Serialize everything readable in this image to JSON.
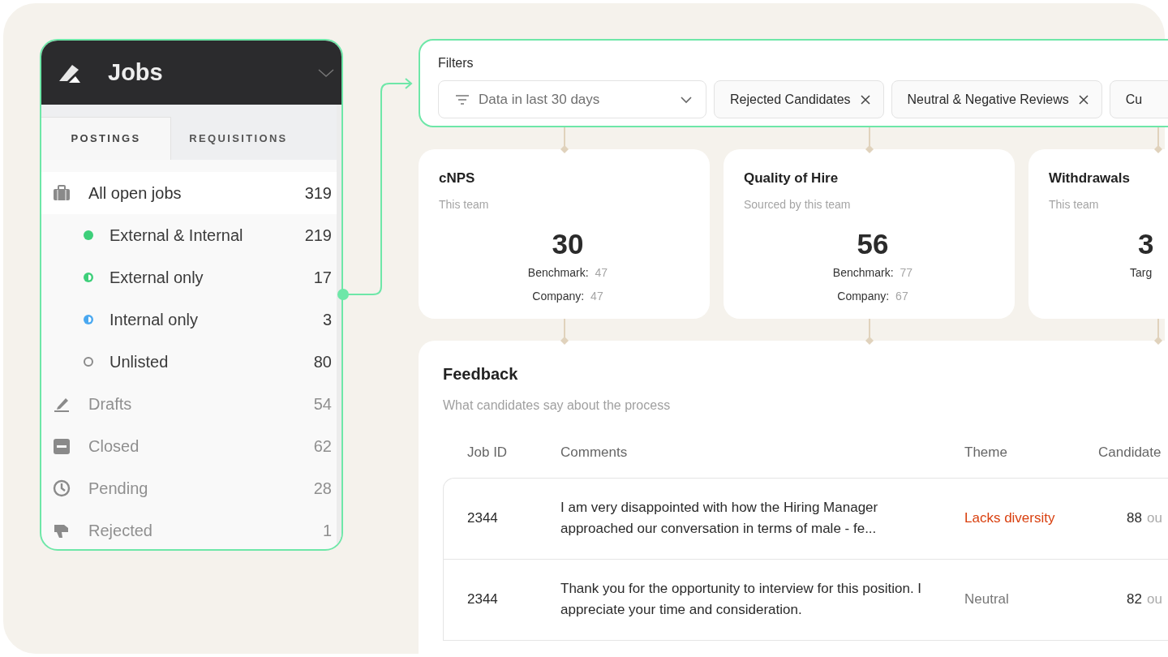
{
  "sidebar": {
    "title": "Jobs",
    "tabs": [
      {
        "label": "POSTINGS",
        "selected": true
      },
      {
        "label": "REQUISITIONS",
        "selected": false
      }
    ],
    "items": [
      {
        "label": "All open jobs",
        "count": "319",
        "kind": "briefcase",
        "selected": true,
        "children": [
          {
            "label": "External & Internal",
            "count": "219",
            "kind": "full",
            "color": "#3ecf7a"
          },
          {
            "label": "External only",
            "count": "17",
            "kind": "half",
            "color": "#3ecf7a"
          },
          {
            "label": "Internal only",
            "count": "3",
            "kind": "half",
            "color": "#4aa8f0"
          },
          {
            "label": "Unlisted",
            "count": "80",
            "kind": "ring",
            "color": "#8a8a8a"
          }
        ]
      },
      {
        "label": "Drafts",
        "count": "54",
        "kind": "pen",
        "selected": false
      },
      {
        "label": "Closed",
        "count": "62",
        "kind": "closed",
        "selected": false
      },
      {
        "label": "Pending",
        "count": "28",
        "kind": "clock",
        "selected": false
      },
      {
        "label": "Rejected",
        "count": "1",
        "kind": "thumb",
        "selected": false
      }
    ]
  },
  "filters": {
    "label": "Filters",
    "dropdown": {
      "value": "Data in last 30 days"
    },
    "chips": [
      "Rejected Candidates",
      "Neutral & Negative Reviews",
      "Cu"
    ]
  },
  "stats": [
    {
      "title": "cNPS",
      "subtitle": "This team",
      "value": "30",
      "rows": [
        {
          "label": "Benchmark:",
          "value": "47"
        },
        {
          "label": "Company:",
          "value": "47"
        }
      ]
    },
    {
      "title": "Quality of Hire",
      "subtitle": "Sourced by this team",
      "value": "56",
      "rows": [
        {
          "label": "Benchmark:",
          "value": "77"
        },
        {
          "label": "Company:",
          "value": "67"
        }
      ]
    },
    {
      "title": "Withdrawals",
      "subtitle": "This team",
      "value": "3",
      "rows": [
        {
          "label": "Targ"
        }
      ]
    }
  ],
  "feedback": {
    "title": "Feedback",
    "subtitle": "What candidates say about the process",
    "columns": [
      "Job ID",
      "Comments",
      "Theme",
      "Candidate"
    ],
    "rows": [
      {
        "job_id": "2344",
        "comment": "I am very disappointed with how the Hiring Manager approached our conversation in terms of male - fe...",
        "theme": "Lacks diversity",
        "color": "#d9400f",
        "score": "88",
        "score_suffix": "ou"
      },
      {
        "job_id": "2344",
        "comment": "Thank you for the opportunity to interview for this position. I appreciate your time and consideration.",
        "theme": "Neutral",
        "color": "#777777",
        "score": "82",
        "score_suffix": "ou"
      }
    ]
  }
}
